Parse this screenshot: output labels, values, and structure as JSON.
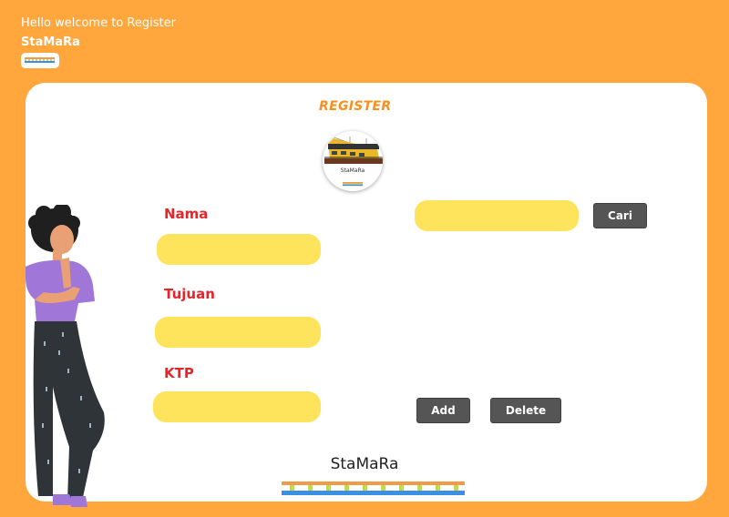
{
  "header": {
    "welcome": "Hello welcome to Register",
    "brand": "StaMaRa"
  },
  "form": {
    "title": "REGISTER",
    "logo_label": "StaMaRa",
    "nama_label": "Nama",
    "nama_value": "",
    "tujuan_label": "Tujuan",
    "tujuan_value": "",
    "ktp_label": "KTP",
    "ktp_value": "",
    "search_value": "",
    "cari_label": "Cari",
    "add_label": "Add",
    "delete_label": "Delete"
  },
  "footer": {
    "brand": "StaMaRa"
  },
  "colors": {
    "background": "#FFA63D",
    "input": "#FEE45D",
    "label": "#E4262B",
    "button": "#555555",
    "title": "#F7901E"
  }
}
